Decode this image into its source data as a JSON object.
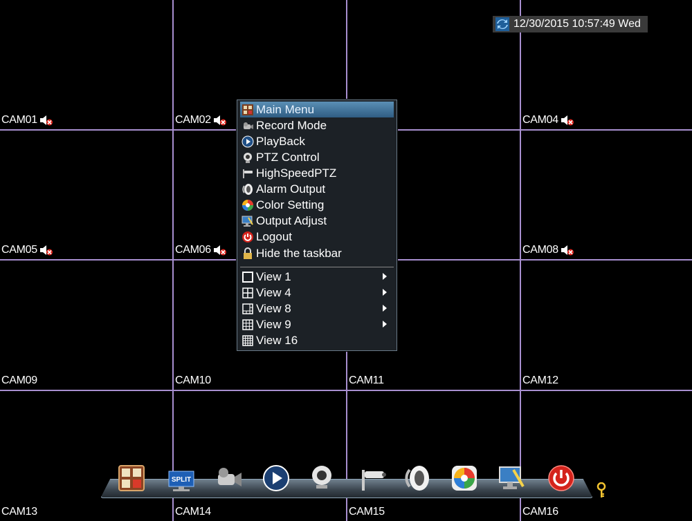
{
  "datetime": "12/30/2015 10:57:49 Wed",
  "cameras": [
    {
      "label": "CAM01",
      "muted": true
    },
    {
      "label": "CAM02",
      "muted": true
    },
    {
      "label": "",
      "muted": true
    },
    {
      "label": "CAM04",
      "muted": true
    },
    {
      "label": "CAM05",
      "muted": true
    },
    {
      "label": "CAM06",
      "muted": true
    },
    {
      "label": "",
      "muted": true
    },
    {
      "label": "CAM08",
      "muted": true
    },
    {
      "label": "CAM09",
      "muted": false
    },
    {
      "label": "CAM10",
      "muted": false
    },
    {
      "label": "CAM11",
      "muted": false
    },
    {
      "label": "CAM12",
      "muted": false
    },
    {
      "label": "CAM13",
      "muted": false
    },
    {
      "label": "CAM14",
      "muted": false
    },
    {
      "label": "CAM15",
      "muted": false
    },
    {
      "label": "CAM16",
      "muted": false
    }
  ],
  "context_menu": {
    "items": [
      {
        "label": "Main Menu",
        "icon": "main-menu-icon",
        "active": true
      },
      {
        "label": "Record Mode",
        "icon": "record-icon"
      },
      {
        "label": "PlayBack",
        "icon": "playback-icon"
      },
      {
        "label": "PTZ Control",
        "icon": "ptz-icon"
      },
      {
        "label": "HighSpeedPTZ",
        "icon": "highspeed-ptz-icon"
      },
      {
        "label": "Alarm Output",
        "icon": "alarm-output-icon"
      },
      {
        "label": "Color Setting",
        "icon": "color-setting-icon"
      },
      {
        "label": "Output Adjust",
        "icon": "output-adjust-icon"
      },
      {
        "label": "Logout",
        "icon": "logout-icon"
      },
      {
        "label": "Hide the taskbar",
        "icon": "lock-icon"
      }
    ],
    "views": [
      {
        "label": "View 1",
        "icon": "view-1-icon",
        "submenu": true
      },
      {
        "label": "View 4",
        "icon": "view-4-icon",
        "submenu": true
      },
      {
        "label": "View 8",
        "icon": "view-8-icon",
        "submenu": true
      },
      {
        "label": "View 9",
        "icon": "view-9-icon",
        "submenu": true
      },
      {
        "label": "View 16",
        "icon": "view-16-icon",
        "submenu": false
      }
    ]
  },
  "taskbar": {
    "items": [
      "main-menu-icon",
      "split-icon",
      "record-icon",
      "playback-icon",
      "ptz-icon",
      "highspeed-ptz-icon",
      "alarm-output-icon",
      "color-setting-icon",
      "output-adjust-icon",
      "logout-icon"
    ],
    "split_label": "SPLIT"
  },
  "colors": {
    "grid_line": "#a88fd0",
    "menu_highlight": "#3f73a0",
    "taskbar": "#4a5661"
  }
}
